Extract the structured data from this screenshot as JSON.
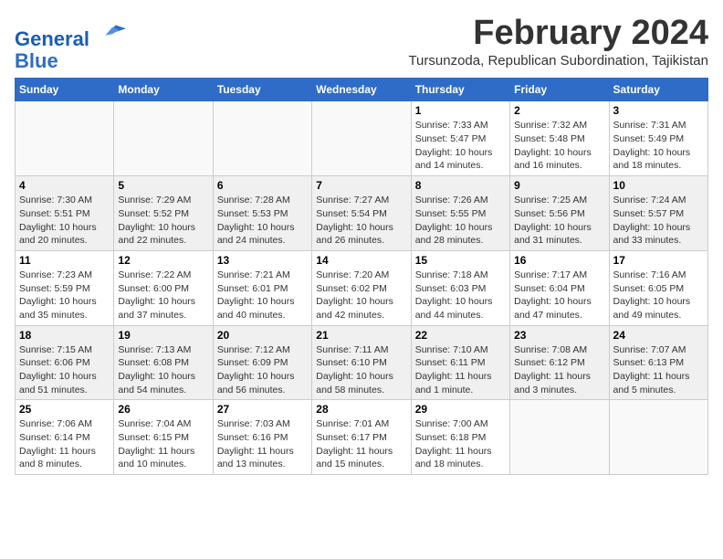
{
  "header": {
    "logo_line1": "General",
    "logo_line2": "Blue",
    "month_title": "February 2024",
    "location": "Tursunzoda, Republican Subordination, Tajikistan"
  },
  "weekdays": [
    "Sunday",
    "Monday",
    "Tuesday",
    "Wednesday",
    "Thursday",
    "Friday",
    "Saturday"
  ],
  "weeks": [
    [
      {
        "day": "",
        "info": ""
      },
      {
        "day": "",
        "info": ""
      },
      {
        "day": "",
        "info": ""
      },
      {
        "day": "",
        "info": ""
      },
      {
        "day": "1",
        "info": "Sunrise: 7:33 AM\nSunset: 5:47 PM\nDaylight: 10 hours\nand 14 minutes."
      },
      {
        "day": "2",
        "info": "Sunrise: 7:32 AM\nSunset: 5:48 PM\nDaylight: 10 hours\nand 16 minutes."
      },
      {
        "day": "3",
        "info": "Sunrise: 7:31 AM\nSunset: 5:49 PM\nDaylight: 10 hours\nand 18 minutes."
      }
    ],
    [
      {
        "day": "4",
        "info": "Sunrise: 7:30 AM\nSunset: 5:51 PM\nDaylight: 10 hours\nand 20 minutes."
      },
      {
        "day": "5",
        "info": "Sunrise: 7:29 AM\nSunset: 5:52 PM\nDaylight: 10 hours\nand 22 minutes."
      },
      {
        "day": "6",
        "info": "Sunrise: 7:28 AM\nSunset: 5:53 PM\nDaylight: 10 hours\nand 24 minutes."
      },
      {
        "day": "7",
        "info": "Sunrise: 7:27 AM\nSunset: 5:54 PM\nDaylight: 10 hours\nand 26 minutes."
      },
      {
        "day": "8",
        "info": "Sunrise: 7:26 AM\nSunset: 5:55 PM\nDaylight: 10 hours\nand 28 minutes."
      },
      {
        "day": "9",
        "info": "Sunrise: 7:25 AM\nSunset: 5:56 PM\nDaylight: 10 hours\nand 31 minutes."
      },
      {
        "day": "10",
        "info": "Sunrise: 7:24 AM\nSunset: 5:57 PM\nDaylight: 10 hours\nand 33 minutes."
      }
    ],
    [
      {
        "day": "11",
        "info": "Sunrise: 7:23 AM\nSunset: 5:59 PM\nDaylight: 10 hours\nand 35 minutes."
      },
      {
        "day": "12",
        "info": "Sunrise: 7:22 AM\nSunset: 6:00 PM\nDaylight: 10 hours\nand 37 minutes."
      },
      {
        "day": "13",
        "info": "Sunrise: 7:21 AM\nSunset: 6:01 PM\nDaylight: 10 hours\nand 40 minutes."
      },
      {
        "day": "14",
        "info": "Sunrise: 7:20 AM\nSunset: 6:02 PM\nDaylight: 10 hours\nand 42 minutes."
      },
      {
        "day": "15",
        "info": "Sunrise: 7:18 AM\nSunset: 6:03 PM\nDaylight: 10 hours\nand 44 minutes."
      },
      {
        "day": "16",
        "info": "Sunrise: 7:17 AM\nSunset: 6:04 PM\nDaylight: 10 hours\nand 47 minutes."
      },
      {
        "day": "17",
        "info": "Sunrise: 7:16 AM\nSunset: 6:05 PM\nDaylight: 10 hours\nand 49 minutes."
      }
    ],
    [
      {
        "day": "18",
        "info": "Sunrise: 7:15 AM\nSunset: 6:06 PM\nDaylight: 10 hours\nand 51 minutes."
      },
      {
        "day": "19",
        "info": "Sunrise: 7:13 AM\nSunset: 6:08 PM\nDaylight: 10 hours\nand 54 minutes."
      },
      {
        "day": "20",
        "info": "Sunrise: 7:12 AM\nSunset: 6:09 PM\nDaylight: 10 hours\nand 56 minutes."
      },
      {
        "day": "21",
        "info": "Sunrise: 7:11 AM\nSunset: 6:10 PM\nDaylight: 10 hours\nand 58 minutes."
      },
      {
        "day": "22",
        "info": "Sunrise: 7:10 AM\nSunset: 6:11 PM\nDaylight: 11 hours\nand 1 minute."
      },
      {
        "day": "23",
        "info": "Sunrise: 7:08 AM\nSunset: 6:12 PM\nDaylight: 11 hours\nand 3 minutes."
      },
      {
        "day": "24",
        "info": "Sunrise: 7:07 AM\nSunset: 6:13 PM\nDaylight: 11 hours\nand 5 minutes."
      }
    ],
    [
      {
        "day": "25",
        "info": "Sunrise: 7:06 AM\nSunset: 6:14 PM\nDaylight: 11 hours\nand 8 minutes."
      },
      {
        "day": "26",
        "info": "Sunrise: 7:04 AM\nSunset: 6:15 PM\nDaylight: 11 hours\nand 10 minutes."
      },
      {
        "day": "27",
        "info": "Sunrise: 7:03 AM\nSunset: 6:16 PM\nDaylight: 11 hours\nand 13 minutes."
      },
      {
        "day": "28",
        "info": "Sunrise: 7:01 AM\nSunset: 6:17 PM\nDaylight: 11 hours\nand 15 minutes."
      },
      {
        "day": "29",
        "info": "Sunrise: 7:00 AM\nSunset: 6:18 PM\nDaylight: 11 hours\nand 18 minutes."
      },
      {
        "day": "",
        "info": ""
      },
      {
        "day": "",
        "info": ""
      }
    ]
  ]
}
